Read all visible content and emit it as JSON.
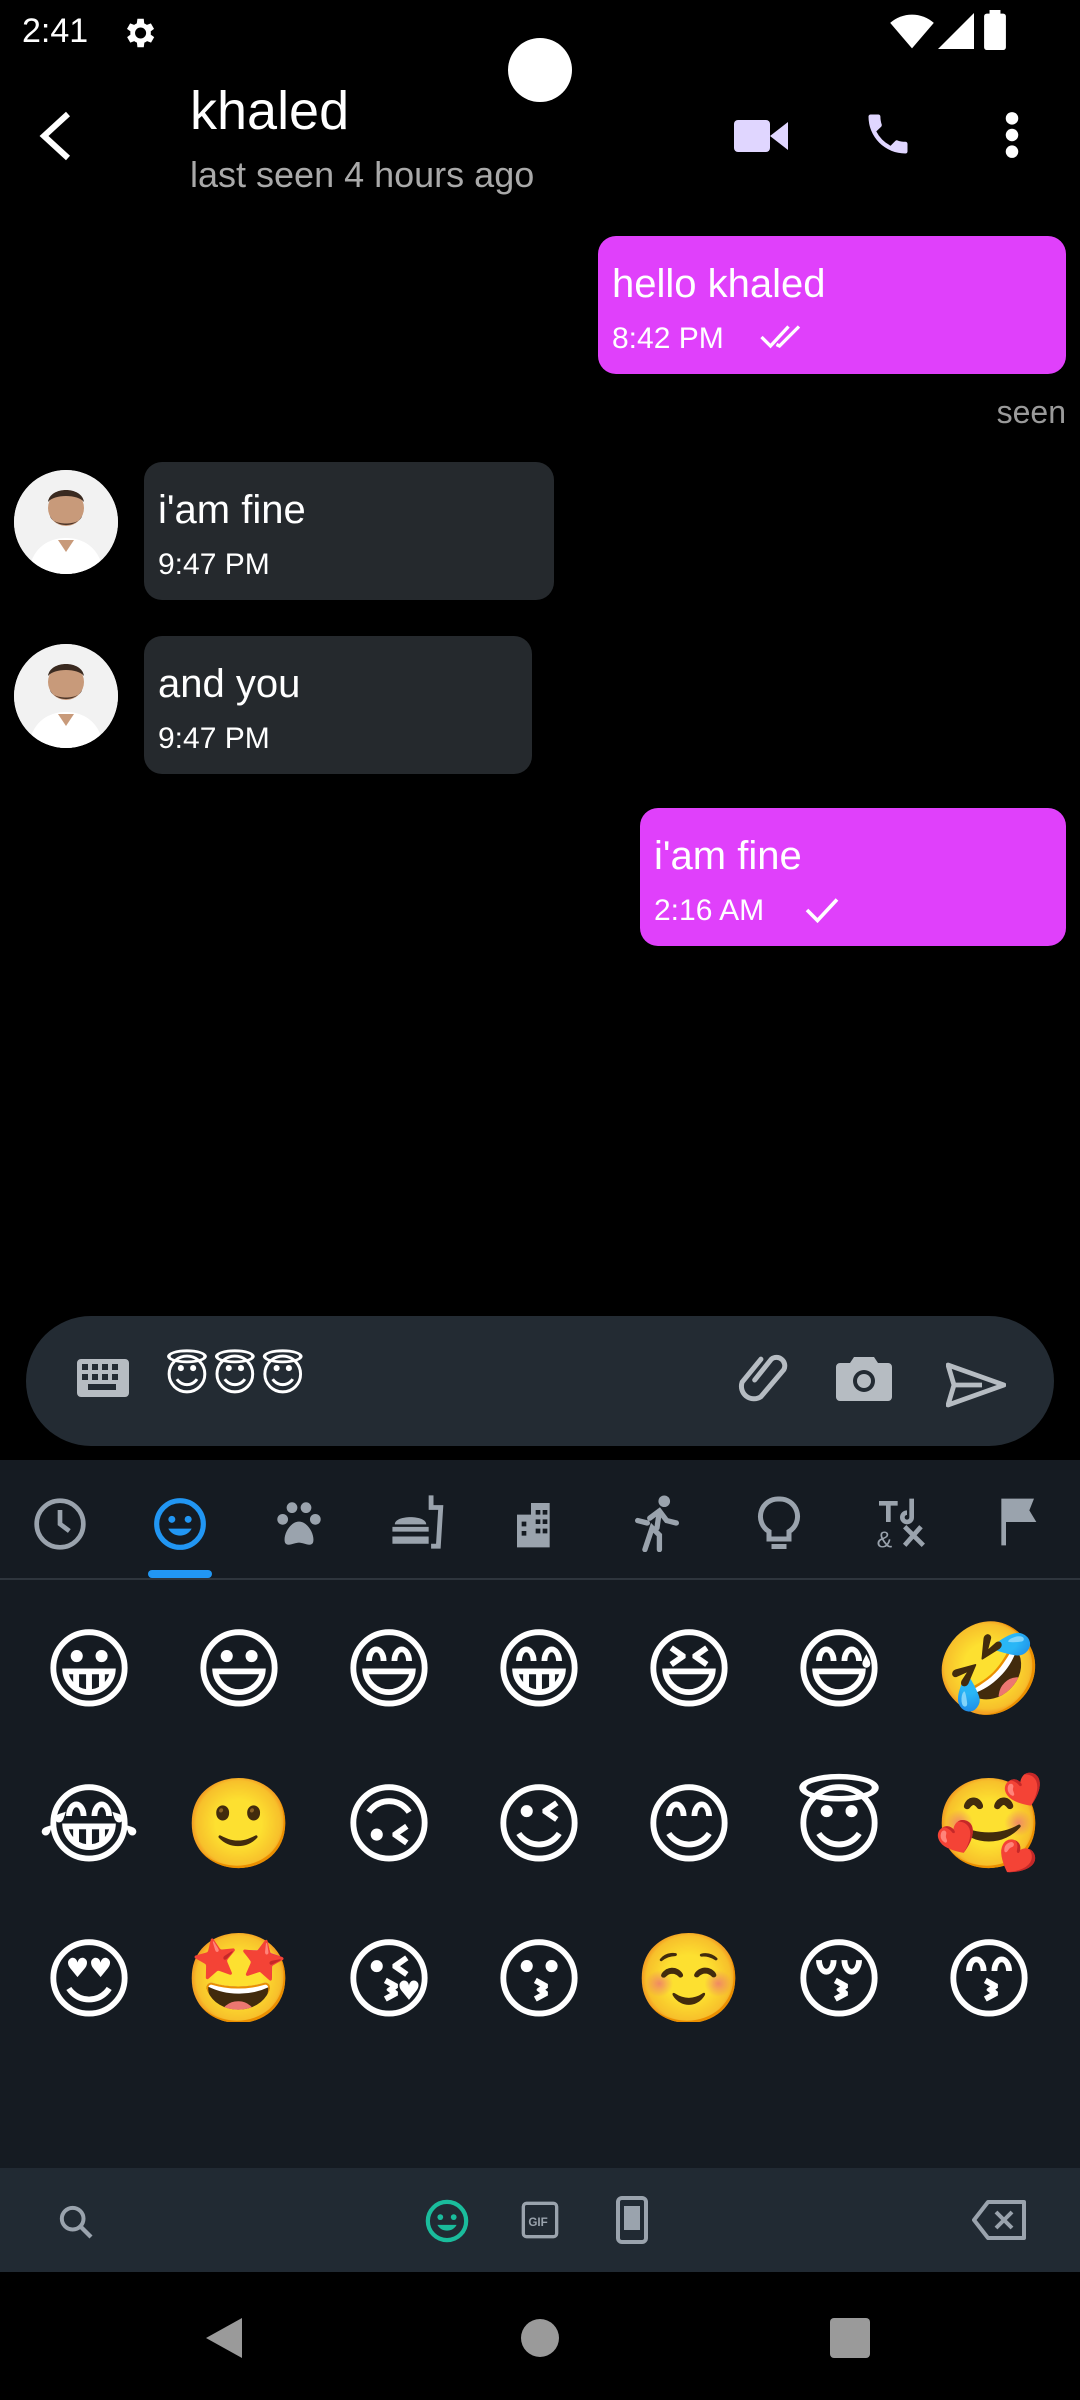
{
  "status_bar": {
    "time": "2:41"
  },
  "header": {
    "title": "khaled",
    "subtitle": "last seen 4 hours ago"
  },
  "messages": [
    {
      "text": "hello khaled",
      "time": "8:42 PM"
    },
    {
      "text": "i'am fine",
      "time": "9:47 PM"
    },
    {
      "text": "and you",
      "time": "9:47 PM"
    },
    {
      "text": "i'am fine",
      "time": "2:16 AM"
    }
  ],
  "seen_label": "seen",
  "composer": {
    "value": "😇😇😇"
  },
  "emoji_categories": [
    "recent-icon",
    "smileys-icon",
    "animals-icon",
    "food-icon",
    "places-icon",
    "activity-icon",
    "objects-icon",
    "symbols-icon",
    "flags-icon"
  ],
  "emojis": [
    "😀",
    "😃",
    "😄",
    "😁",
    "😆",
    "😅",
    "🤣",
    "😂",
    "🙂",
    "🙃",
    "😉",
    "😊",
    "😇",
    "🥰",
    "😍",
    "🤩",
    "😘",
    "😗",
    "☺️",
    "😚",
    "😙",
    "😋",
    "😛",
    "😜",
    "🤪",
    "😝",
    "🤑",
    "🤗"
  ],
  "colors": {
    "accent": "#e040fb",
    "incoming": "#25292d",
    "tab_indicator": "#2196f3"
  }
}
